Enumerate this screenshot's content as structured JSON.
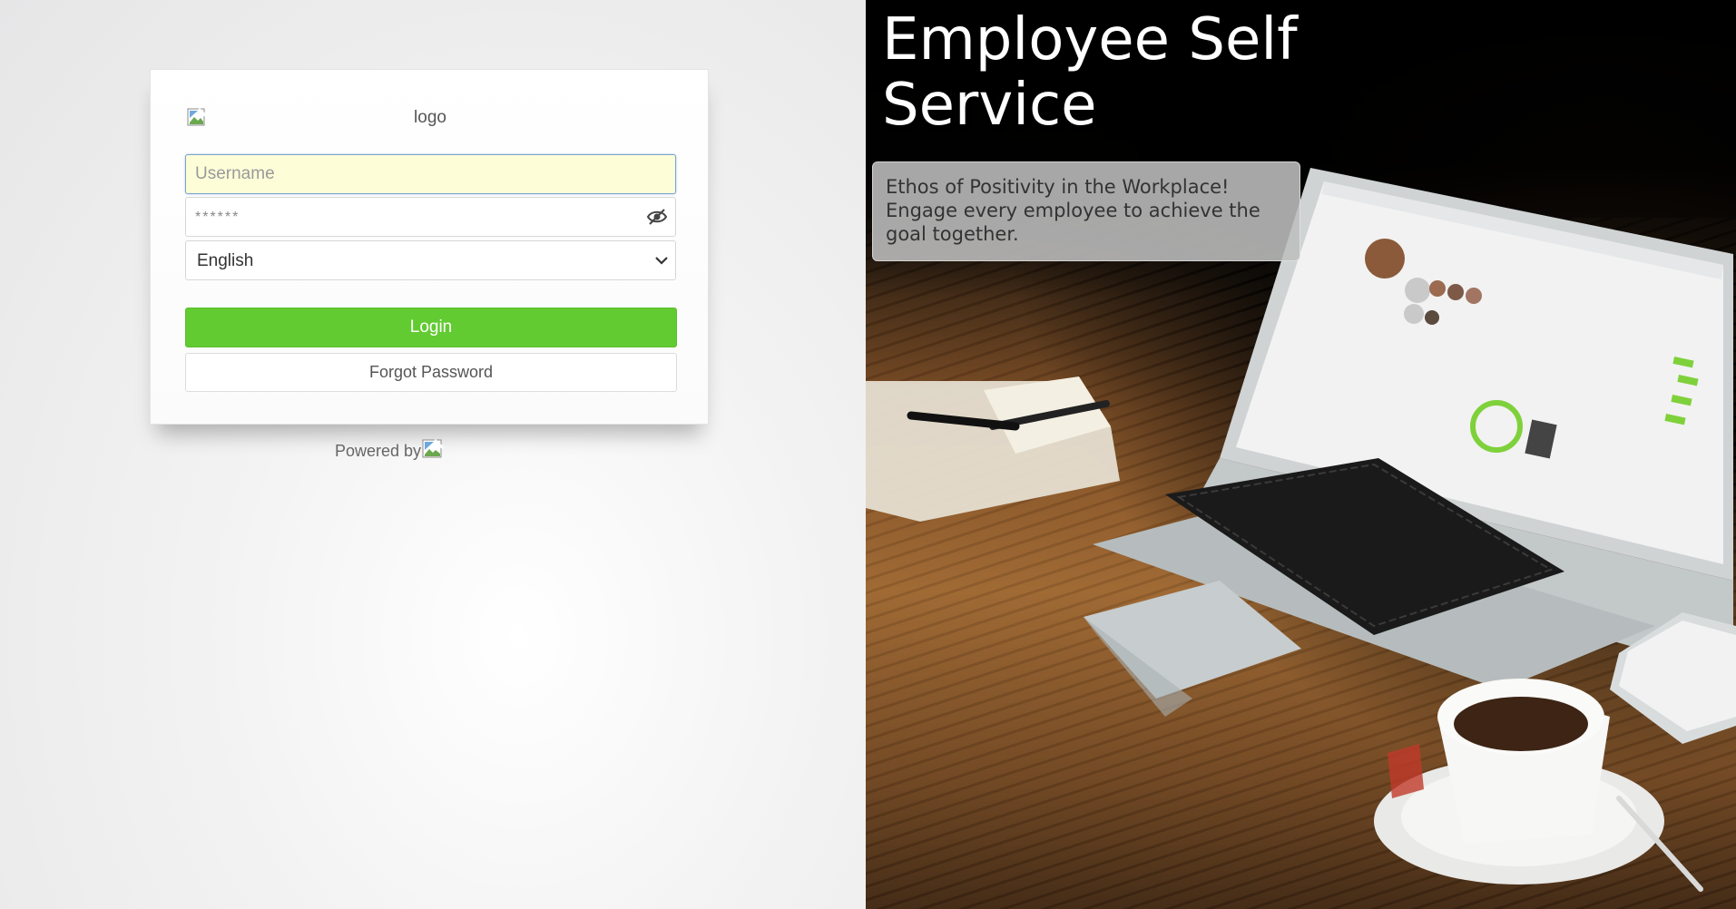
{
  "login": {
    "logo_alt": "logo",
    "username_placeholder": "Username",
    "password_placeholder": "******",
    "language_selected": "English",
    "language_options": [
      "English"
    ],
    "login_label": "Login",
    "forgot_label": "Forgot Password",
    "powered_by": "Powered by"
  },
  "hero": {
    "title": "Employee Self Service",
    "tagline": "Ethos of Positivity in the Workplace! Engage every employee to achieve the goal together."
  },
  "colors": {
    "login_button": "#62cb31",
    "username_field_bg": "#fdfdd8",
    "page_bg": "#ececec"
  },
  "icons": [
    "broken-image-icon",
    "eye-off-icon",
    "chevron-down-icon"
  ]
}
